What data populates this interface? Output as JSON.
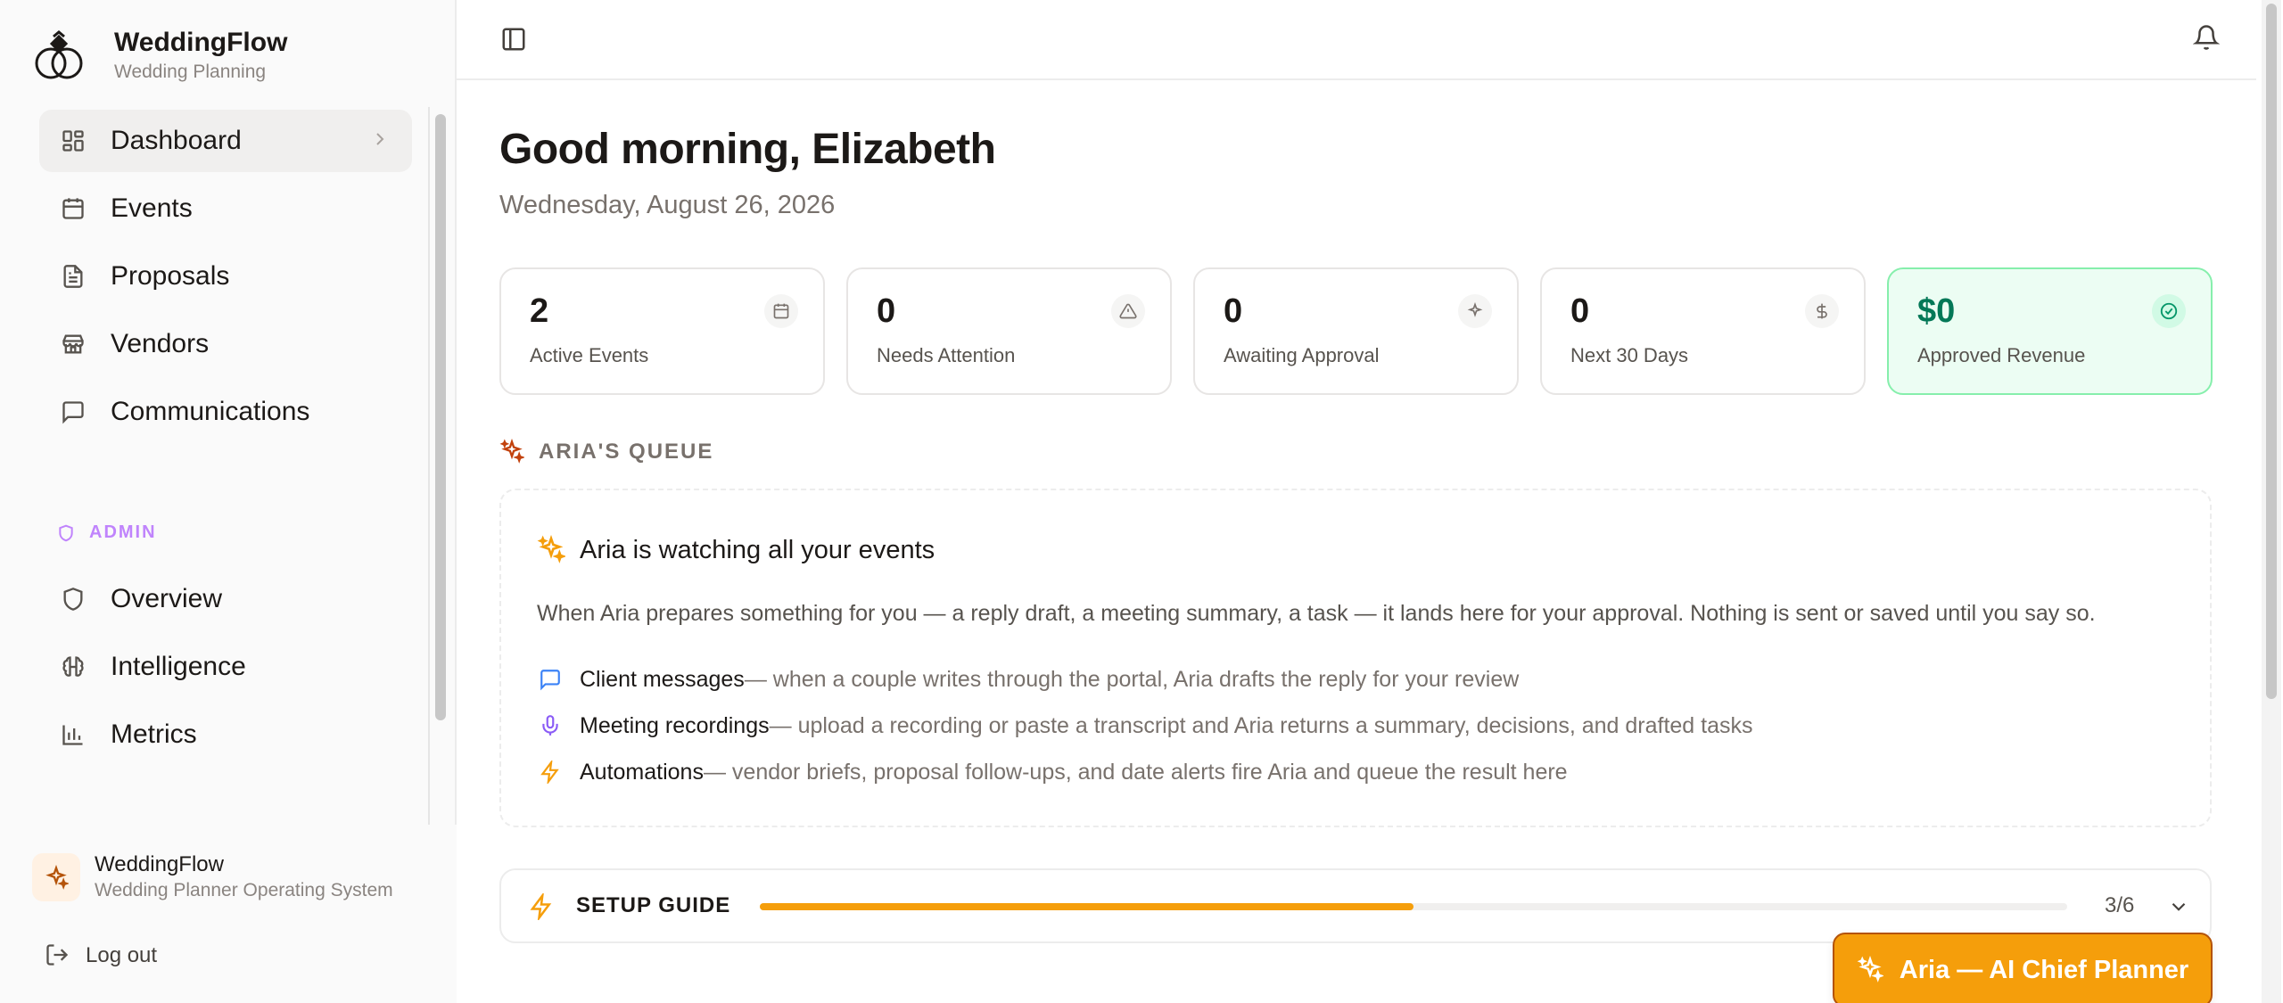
{
  "brand": {
    "name": "WeddingFlow",
    "subtitle": "Wedding Planning"
  },
  "sidebar": {
    "nav": [
      {
        "label": "Dashboard",
        "icon": "dashboard-icon",
        "active": true
      },
      {
        "label": "Events",
        "icon": "calendar-icon"
      },
      {
        "label": "Proposals",
        "icon": "file-text-icon"
      },
      {
        "label": "Vendors",
        "icon": "store-icon"
      },
      {
        "label": "Communications",
        "icon": "message-icon"
      }
    ],
    "admin_label": "ADMIN",
    "admin_nav": [
      {
        "label": "Overview",
        "icon": "shield-icon"
      },
      {
        "label": "Intelligence",
        "icon": "brain-icon"
      },
      {
        "label": "Metrics",
        "icon": "bar-chart-icon"
      }
    ],
    "footer": {
      "org_name": "WeddingFlow",
      "org_subtitle": "Wedding Planner Operating System",
      "logout_label": "Log out"
    }
  },
  "main": {
    "greeting": "Good morning, Elizabeth",
    "date": "Wednesday, August 26, 2026",
    "stats": [
      {
        "value": "2",
        "label": "Active Events",
        "icon": "calendar-icon"
      },
      {
        "value": "0",
        "label": "Needs Attention",
        "icon": "alert-triangle-icon"
      },
      {
        "value": "0",
        "label": "Awaiting Approval",
        "icon": "sparkles-icon"
      },
      {
        "value": "0",
        "label": "Next 30 Days",
        "icon": "dollar-icon"
      },
      {
        "value": "$0",
        "label": "Approved Revenue",
        "icon": "check-circle-icon"
      }
    ],
    "queue": {
      "title": "ARIA'S QUEUE",
      "heading": "Aria is watching all your events",
      "description": "When Aria prepares something for you — a reply draft, a meeting summary, a task — it lands here for your approval. Nothing is sent or saved until you say so.",
      "items": [
        {
          "title": "Client messages",
          "text": " — when a couple writes through the portal, Aria drafts the reply for your review",
          "icon": "chat-icon"
        },
        {
          "title": "Meeting recordings",
          "text": " — upload a recording or paste a transcript and Aria returns a summary, decisions, and drafted tasks",
          "icon": "mic-icon"
        },
        {
          "title": "Automations",
          "text": " — vendor briefs, proposal follow-ups, and date alerts fire Aria and queue the result here",
          "icon": "zap-icon"
        }
      ]
    },
    "setup": {
      "title": "SETUP GUIDE",
      "count": "3/6",
      "progress": 0.5
    },
    "aria_button": "Aria — AI Chief Planner"
  },
  "colors": {
    "accent": "#f59e0b",
    "admin": "#c084fc",
    "success": "#047857"
  }
}
